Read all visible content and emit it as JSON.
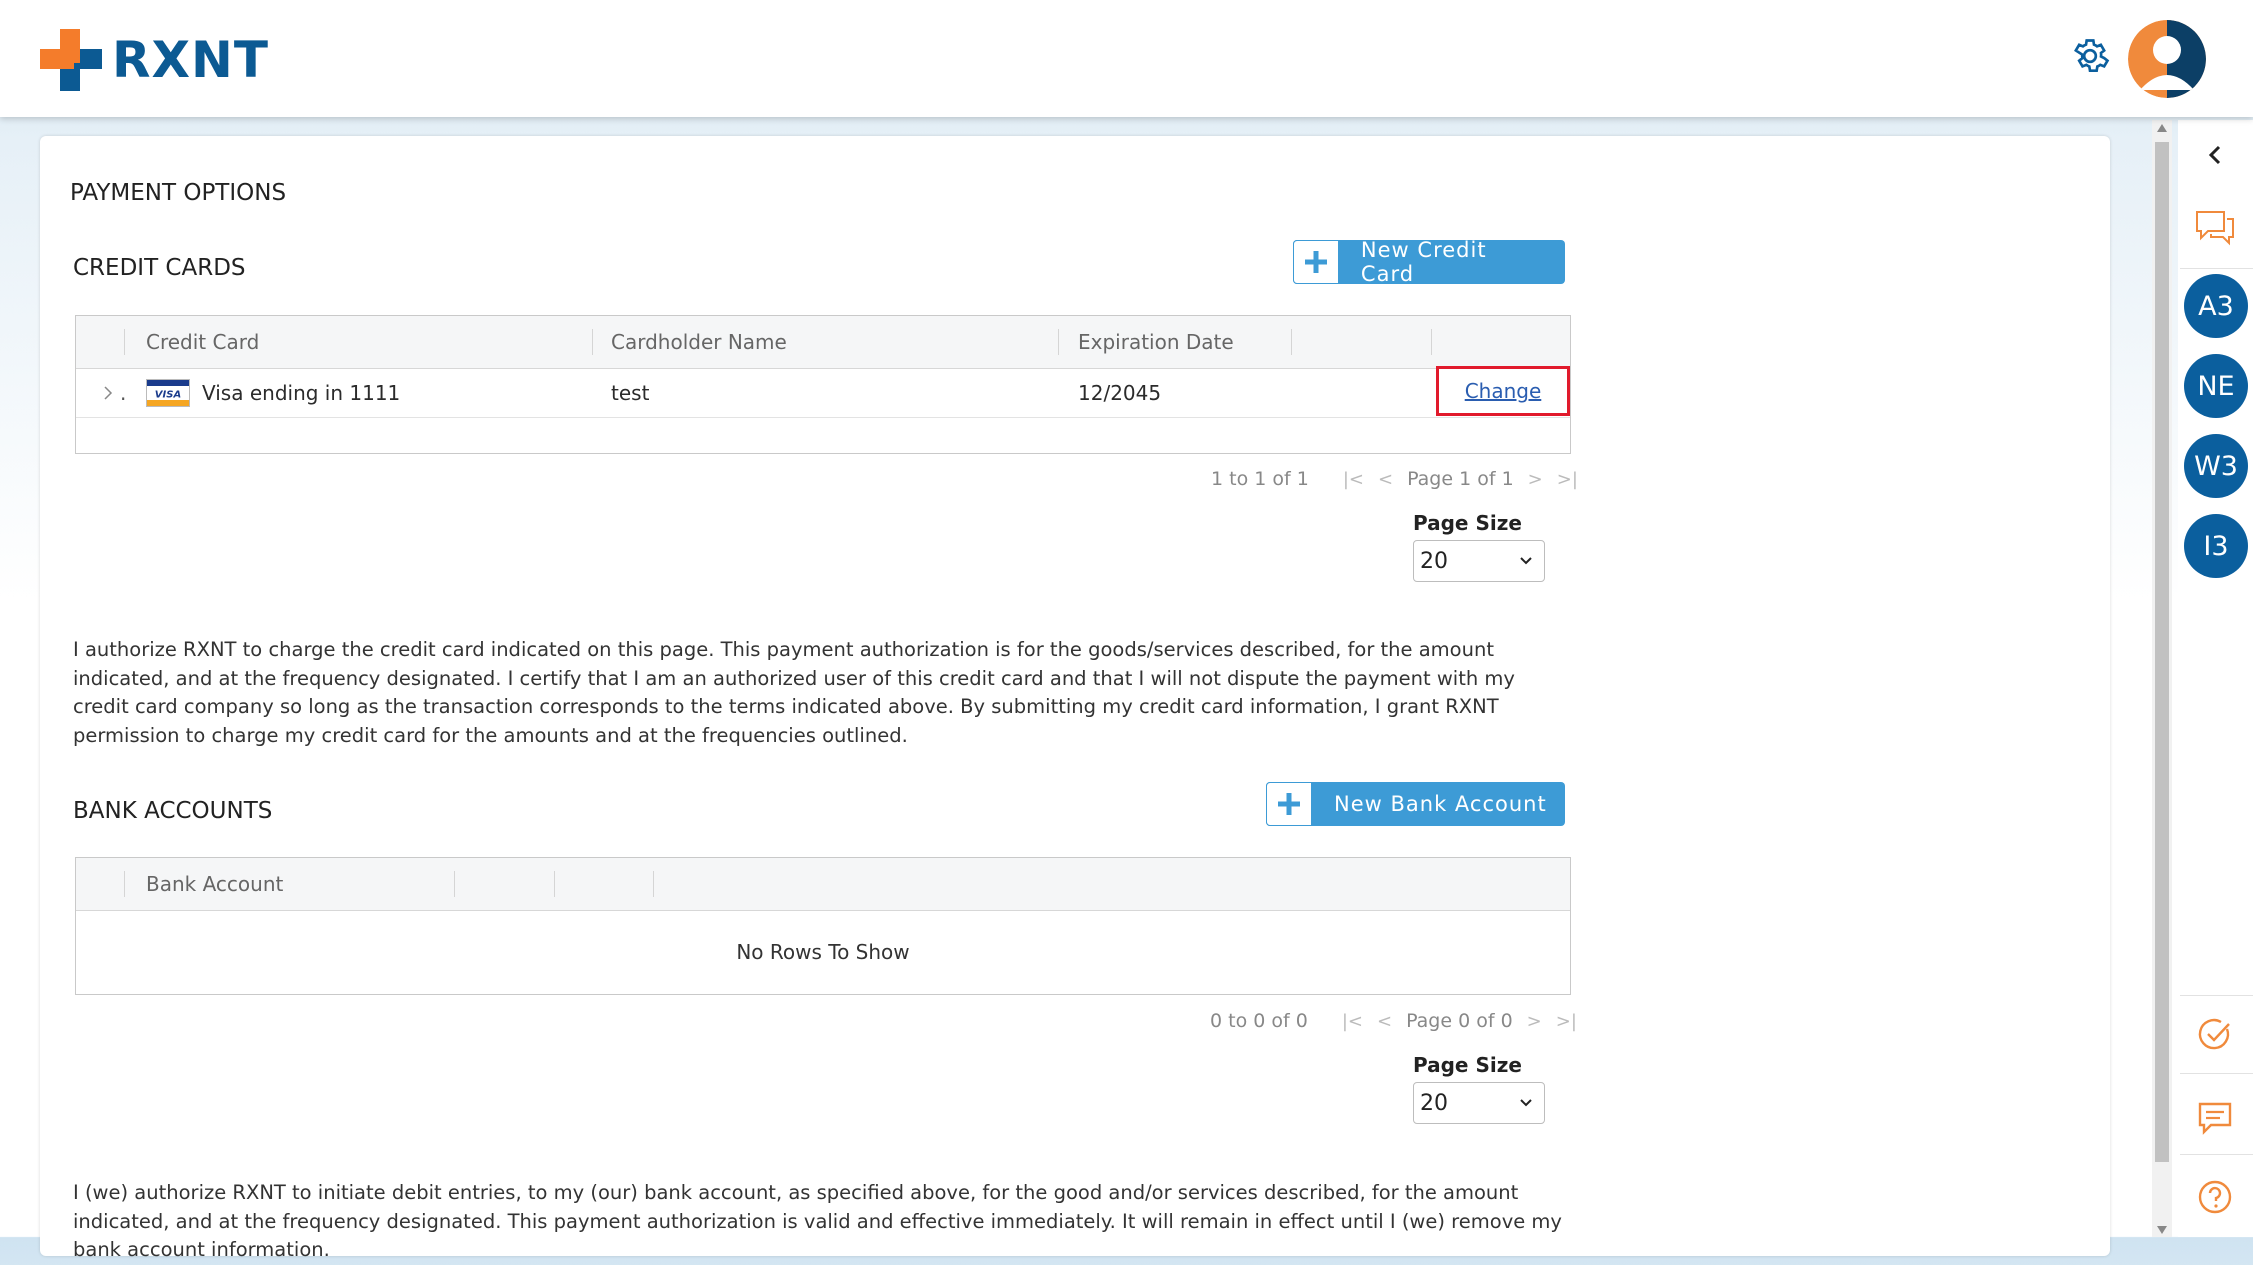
{
  "header": {
    "logo_text": "RXNT",
    "icons": [
      "plus-logo-icon",
      "gear-icon",
      "user-avatar-icon"
    ]
  },
  "page": {
    "title": "PAYMENT OPTIONS"
  },
  "credit_cards": {
    "section_title": "CREDIT CARDS",
    "add_button_label": "New Credit Card",
    "columns": [
      "Credit Card",
      "Cardholder Name",
      "Expiration Date"
    ],
    "rows": [
      {
        "expand": ".",
        "card_icon": "VISA",
        "card": "Visa ending in 1111",
        "cardholder": "test",
        "expiration": "12/2045",
        "action": "Change"
      }
    ],
    "pager": {
      "range": "1 to 1 of 1",
      "page": "Page 1 of 1"
    },
    "page_size_label": "Page Size",
    "page_size_value": "20",
    "authorization_text": "I authorize RXNT to charge the credit card indicated on this page. This payment authorization is for the goods/services described, for the amount indicated, and at the frequency designated. I certify that I am an authorized user of this credit card and that I will not dispute the payment with my credit card company so long as the transaction corresponds to the terms indicated above. By submitting my credit card information, I grant RXNT permission to charge my credit card for the amounts and at the frequencies outlined."
  },
  "bank_accounts": {
    "section_title": "BANK ACCOUNTS",
    "add_button_label": "New Bank Account",
    "columns": [
      "Bank Account"
    ],
    "empty_message": "No Rows To Show",
    "pager": {
      "range": "0 to 0 of 0",
      "page": "Page 0 of 0"
    },
    "page_size_label": "Page Size",
    "page_size_value": "20",
    "authorization_text": "I (we) authorize RXNT to initiate debit entries, to my (our) bank account, as specified above, for the good and/or services described, for the amount indicated, and at the frequency designated. This payment authorization is valid and effective immediately. It will remain in effect until I (we) remove my bank account information."
  },
  "right_rail": {
    "avatars": [
      "A3",
      "NE",
      "W3",
      "I3"
    ],
    "icons": [
      "collapse-chevron-icon",
      "chat-bubbles-icon",
      "task-check-icon",
      "message-icon",
      "help-icon"
    ]
  },
  "colors": {
    "brand_blue": "#0c5a93",
    "brand_orange": "#f47c2b",
    "button_blue": "#3d9bd6",
    "highlight_red": "#e11a2c",
    "rail_orange": "#f08a3c"
  }
}
